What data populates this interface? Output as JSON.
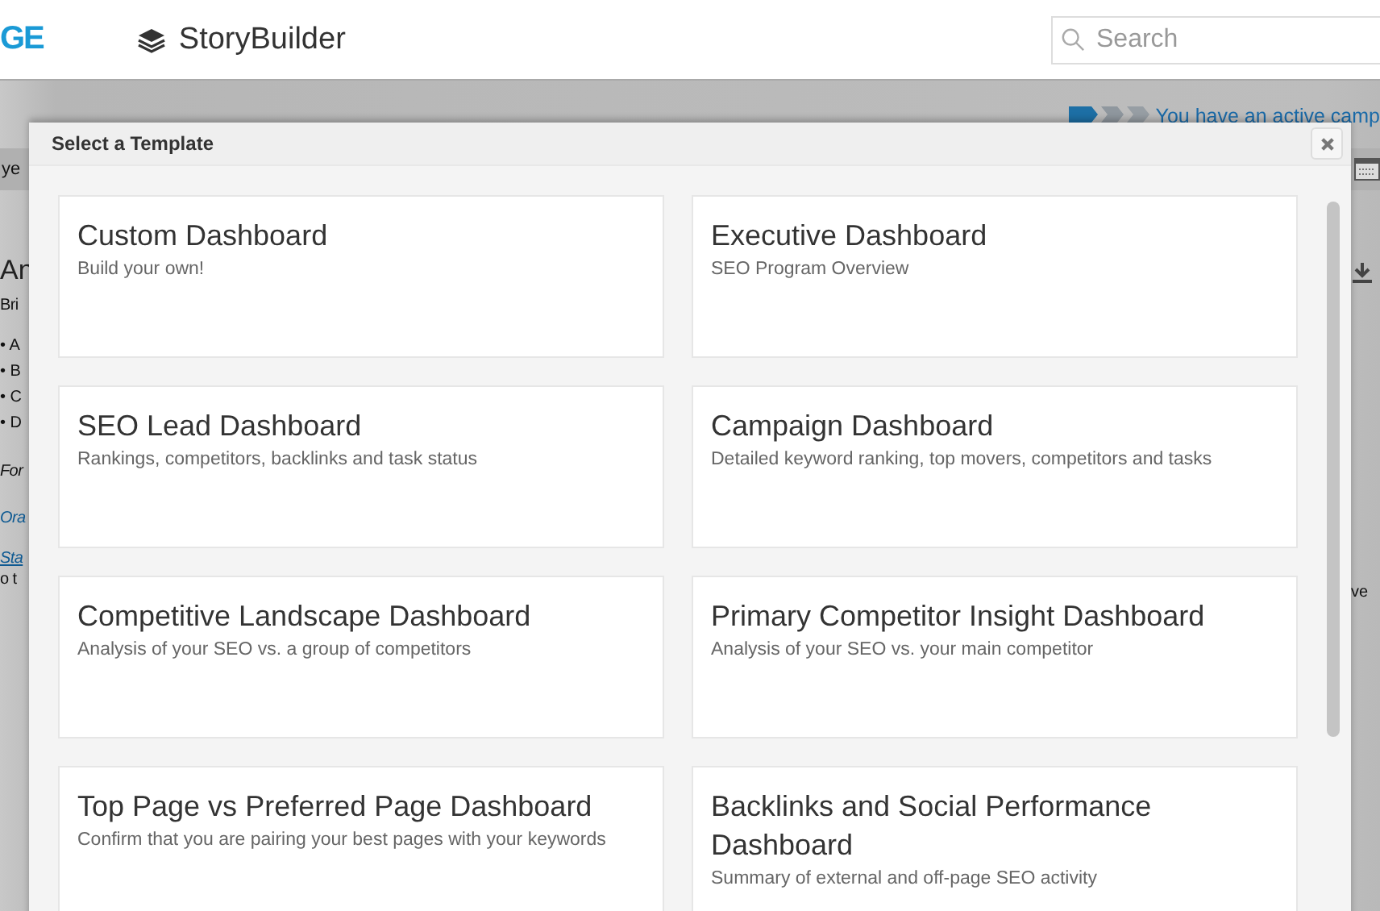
{
  "header": {
    "logo": "GE",
    "app_title": "StoryBuilder",
    "search": {
      "placeholder": "Search"
    }
  },
  "background": {
    "notice": "You have an active camp",
    "toolbar_text": "ye",
    "heading": "An",
    "paragraph": "Bri",
    "bullets": [
      "• A",
      "• B",
      "• C",
      "• D"
    ],
    "note": "For",
    "links": [
      "Ora",
      "Sta"
    ],
    "text_after_link": "o t",
    "right_text": "ve"
  },
  "modal": {
    "title": "Select a Template",
    "templates": [
      {
        "title": "Custom Dashboard",
        "description": "Build your own!"
      },
      {
        "title": "Executive Dashboard",
        "description": "SEO Program Overview"
      },
      {
        "title": "SEO Lead Dashboard",
        "description": "Rankings, competitors, backlinks and task status"
      },
      {
        "title": "Campaign Dashboard",
        "description": "Detailed keyword ranking, top movers, competitors and tasks"
      },
      {
        "title": "Competitive Landscape Dashboard",
        "description": "Analysis of your SEO vs. a group of competitors"
      },
      {
        "title": "Primary Competitor Insight Dashboard",
        "description": "Analysis of your SEO vs. your main competitor"
      },
      {
        "title": "Top Page vs Preferred Page Dashboard",
        "description": "Confirm that you are pairing your best pages with your keywords"
      },
      {
        "title": "Backlinks and Social Performance Dashboard",
        "description": "Summary of external and off-page SEO activity"
      }
    ]
  }
}
